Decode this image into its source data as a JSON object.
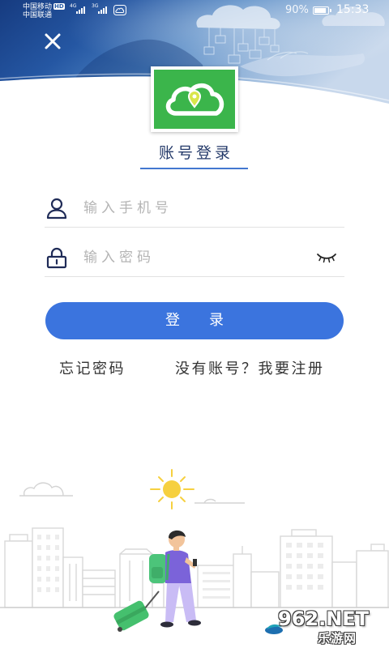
{
  "status_bar": {
    "carrier_primary": "中国移动",
    "carrier_primary_badge": "HD",
    "carrier_secondary": "中国联通",
    "networks": [
      {
        "type": "4G",
        "signal_level": 4
      },
      {
        "type": "3G",
        "signal_level": 4
      }
    ],
    "notification_icon": "cloud-app-icon",
    "battery_text": "90%",
    "battery_level": 0.9,
    "battery_icon": "battery-icon",
    "time": "15:33"
  },
  "header": {
    "close_icon": "close-icon"
  },
  "app_logo": {
    "icon": "cloud-location-pin-icon"
  },
  "login": {
    "title": "账号登录",
    "phone": {
      "icon": "user-icon",
      "placeholder": "输入手机号",
      "value": ""
    },
    "password": {
      "icon": "lock-icon",
      "placeholder": "输入密码",
      "value": "",
      "visibility_icon": "eye-closed-icon"
    },
    "submit_label": "登　　录",
    "forgot_password_label": "忘记密码",
    "register_label": "没有账号？我要注册"
  },
  "watermark": {
    "brand": "962.NET",
    "name": "乐游网"
  },
  "colors": {
    "accent": "#3b74de",
    "title": "#243a6a",
    "icon": "#1f2b57",
    "placeholder": "#b4b4b4",
    "link": "#333333",
    "logo_green": "#3bb54b",
    "header_blue": "#1f4f9e",
    "sun": "#f6d03f",
    "traveler_green": "#45c06e",
    "traveler_purple": "#7b63d9"
  }
}
